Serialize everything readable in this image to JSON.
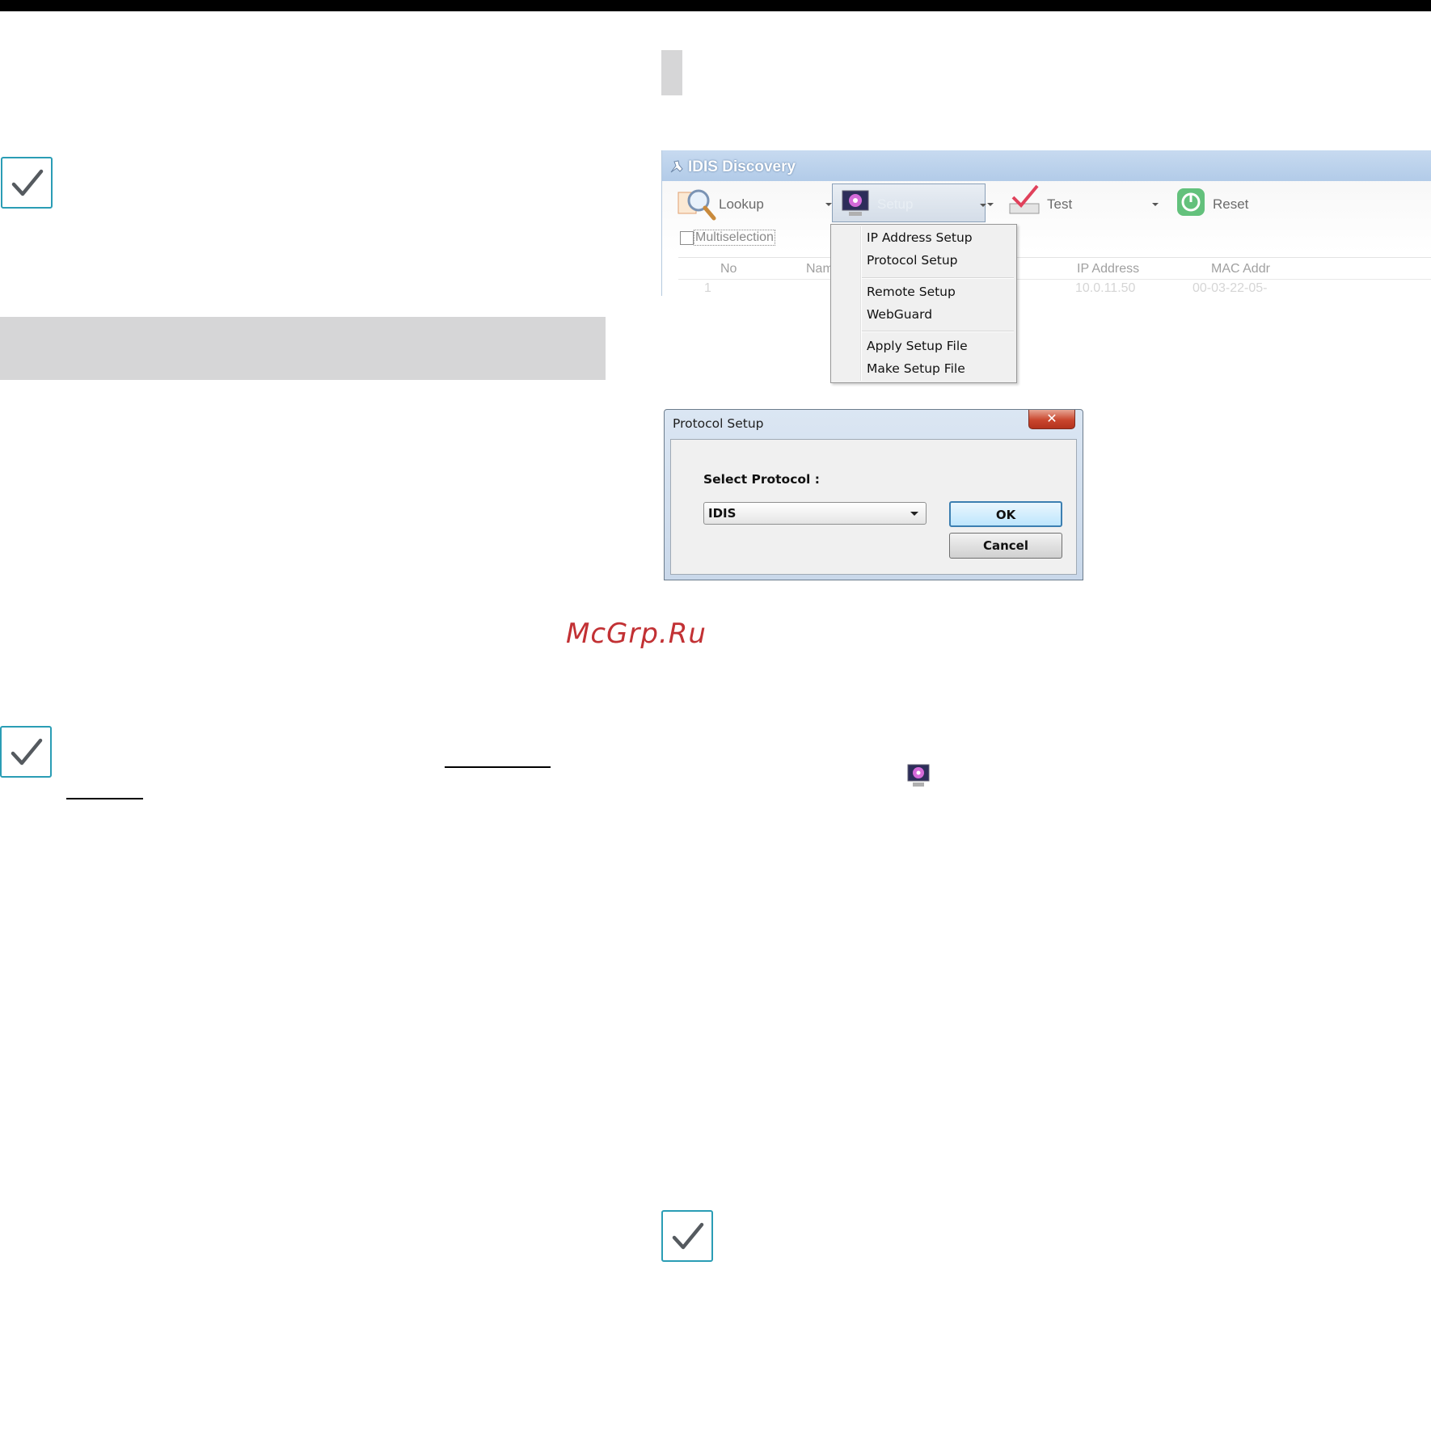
{
  "window": {
    "title": "IDIS Discovery",
    "toolbar": {
      "lookup_label": "Lookup",
      "setup_label": "Setup",
      "test_label": "Test",
      "reset_label": "Reset"
    },
    "multiselection_label": "Multiselection",
    "table": {
      "columns": [
        "No",
        "Nam",
        "IP Address",
        "MAC Addr"
      ],
      "row": [
        "1",
        "10.0.11.50",
        "00-03-22-05-"
      ]
    },
    "icons": {
      "app": "idis-app-icon",
      "lookup": "magnifier-icon",
      "setup": "monitor-gear-icon",
      "test": "checkmark-tray-icon",
      "reset": "power-icon"
    }
  },
  "setup_menu": {
    "items": [
      "IP Address Setup",
      "Protocol Setup",
      "Remote Setup",
      "WebGuard",
      "Apply Setup File",
      "Make Setup File"
    ]
  },
  "protocol_dialog": {
    "title": "Protocol Setup",
    "close_label": "✕",
    "select_label": "Select Protocol :",
    "selected_protocol": "IDIS",
    "ok_label": "OK",
    "cancel_label": "Cancel"
  },
  "watermark": "McGrp.Ru",
  "colors": {
    "check_border": "#2a9db5",
    "band_grey": "#d6d6d7",
    "watermark": "#c23134"
  }
}
